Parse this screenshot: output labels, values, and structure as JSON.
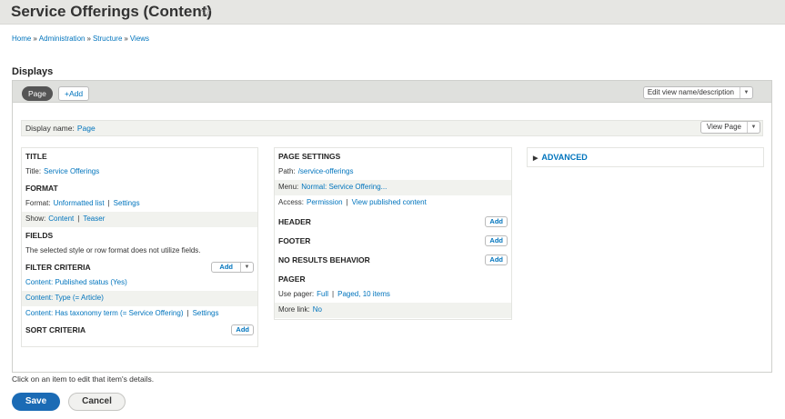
{
  "header": {
    "title": "Service Offerings (Content)",
    "star_icon": "star-outline-icon"
  },
  "breadcrumb": [
    "Home",
    "Administration",
    "Structure",
    "Views"
  ],
  "breadcrumb_separator": "»",
  "displays": {
    "heading": "Displays",
    "tabs": [
      {
        "label": "Page",
        "active": true
      }
    ],
    "add_label": "+Add",
    "edit_view_label": "Edit view name/description",
    "display_name_label": "Display name:",
    "display_name_value": "Page",
    "view_page_label": "View Page"
  },
  "col1": {
    "title": {
      "heading": "TITLE",
      "label": "Title:",
      "value": "Service Offerings"
    },
    "format": {
      "heading": "FORMAT",
      "format_label": "Format:",
      "format_value": "Unformatted list",
      "settings": "Settings",
      "show_label": "Show:",
      "show_value": "Content",
      "teaser": "Teaser"
    },
    "fields": {
      "heading": "FIELDS",
      "note": "The selected style or row format does not utilize fields."
    },
    "filter": {
      "heading": "FILTER CRITERIA",
      "add_label": "Add",
      "items": [
        "Content: Published status (Yes)",
        "Content: Type (= Article)",
        "Content: Has taxonomy term (= Service Offering)"
      ],
      "item_settings": "Settings"
    },
    "sort": {
      "heading": "SORT CRITERIA",
      "add_label": "Add"
    }
  },
  "col2": {
    "page_settings": {
      "heading": "PAGE SETTINGS",
      "path_label": "Path:",
      "path_value": "/service-offerings",
      "menu_label": "Menu:",
      "menu_value": "Normal: Service Offering...",
      "access_label": "Access:",
      "access_value": "Permission",
      "access_link": "View published content"
    },
    "header": {
      "heading": "HEADER",
      "add_label": "Add"
    },
    "footer": {
      "heading": "FOOTER",
      "add_label": "Add"
    },
    "no_results": {
      "heading": "NO RESULTS BEHAVIOR",
      "add_label": "Add"
    },
    "pager": {
      "heading": "PAGER",
      "use_pager_label": "Use pager:",
      "use_pager_value": "Full",
      "use_pager_link": "Paged, 10 items",
      "more_link_label": "More link:",
      "more_link_value": "No"
    }
  },
  "col3": {
    "advanced_label": "ADVANCED"
  },
  "help_text": "Click on an item to edit that item's details.",
  "actions": {
    "save": "Save",
    "cancel": "Cancel"
  },
  "colors": {
    "link": "#0074bd",
    "primary": "#1b6bb5",
    "header_bg": "#e6e6e3"
  }
}
